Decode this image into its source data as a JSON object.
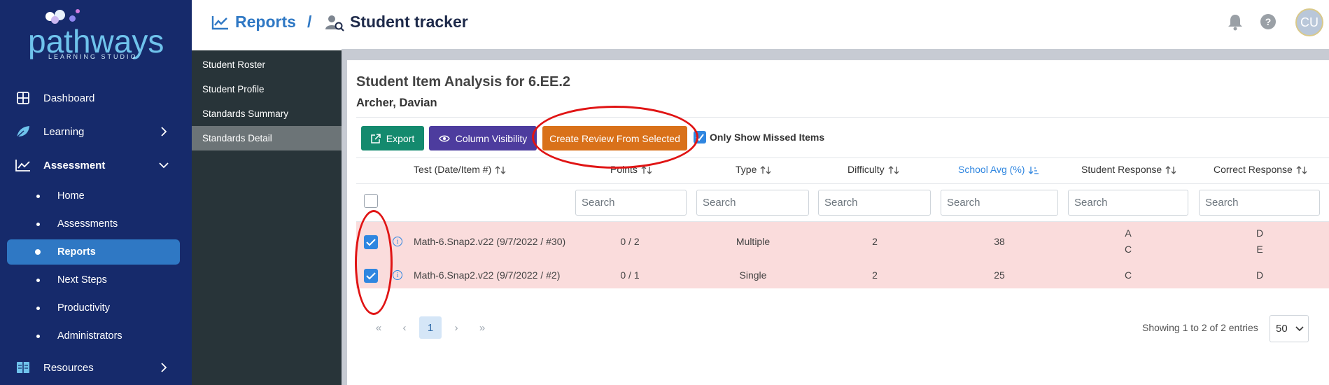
{
  "brand": {
    "name": "pathways",
    "tagline": "LEARNING STUDIO"
  },
  "nav": {
    "dashboard": "Dashboard",
    "learning": "Learning",
    "assessment": "Assessment",
    "assessment_items": [
      "Home",
      "Assessments",
      "Reports",
      "Next Steps",
      "Productivity",
      "Administrators"
    ],
    "resources": "Resources"
  },
  "subnav": [
    "Student Roster",
    "Student Profile",
    "Standards Summary",
    "Standards Detail"
  ],
  "header": {
    "crumb_reports": "Reports",
    "crumb_sep": "/",
    "crumb_tracker": "Student tracker",
    "avatar": "CU"
  },
  "card": {
    "title": "Student Item Analysis for 6.EE.2",
    "student": "Archer, Davian"
  },
  "toolbar": {
    "export": "Export",
    "column_visibility": "Column Visibility",
    "create_review": "Create Review From Selected",
    "only_missed": "Only Show Missed Items",
    "only_missed_checked": true
  },
  "table": {
    "headers": [
      "Test (Date/Item #)",
      "Points",
      "Type",
      "Difficulty",
      "School Avg (%)",
      "Student Response",
      "Correct Response"
    ],
    "search_placeholder": "Search",
    "rows": [
      {
        "checked": true,
        "test": "Math-6.Snap2.v22 (9/7/2022 / #30)",
        "points": "0 / 2",
        "type": "Multiple",
        "difficulty": "2",
        "school_avg": "38",
        "student_response": [
          "A",
          "C"
        ],
        "correct_response": [
          "D",
          "E"
        ]
      },
      {
        "checked": true,
        "test": "Math-6.Snap2.v22 (9/7/2022 / #2)",
        "points": "0 / 1",
        "type": "Single",
        "difficulty": "2",
        "school_avg": "25",
        "student_response": [
          "C"
        ],
        "correct_response": [
          "D"
        ]
      }
    ]
  },
  "pagination": {
    "first": "«",
    "prev": "‹",
    "current": "1",
    "next": "›",
    "last": "»",
    "showing": "Showing 1 to 2 of 2 entries",
    "page_size": "50"
  },
  "colors": {
    "nav_bg": "#162a6b",
    "accent": "#2f78c4",
    "export": "#148a6e",
    "colvis": "#4d3c9e",
    "create": "#d9711a",
    "row_missed": "#fadcdc",
    "annotation": "#e01414"
  }
}
